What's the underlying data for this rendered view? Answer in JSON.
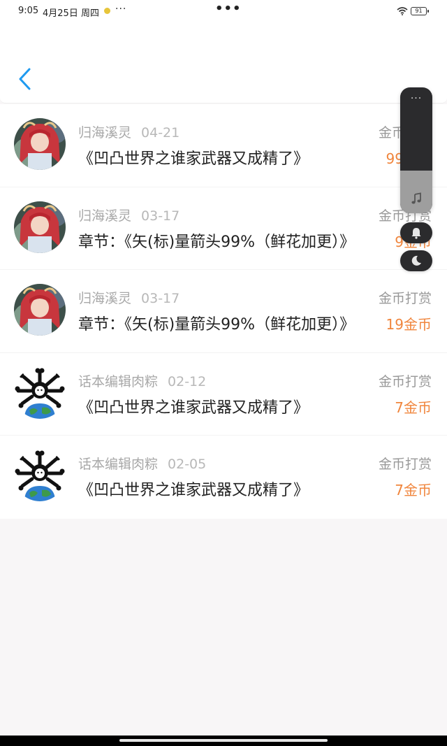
{
  "status_bar": {
    "time": "9:05",
    "date": "4月25日 周四",
    "more": "···",
    "center_dots": "•••",
    "battery": "91"
  },
  "header": {
    "back_icon": "chevron-left-icon",
    "accent": "#1e9af0"
  },
  "records": [
    {
      "user": "归海溪灵",
      "date": "04-21",
      "title": "《凹凸世界之谁家武器又成精了》",
      "type": "金币打赏",
      "amount": "99金币",
      "avatar": "anime-girl-avatar"
    },
    {
      "user": "归海溪灵",
      "date": "03-17",
      "title": "章节：《矢(标)量箭头99%（鲜花加更）》",
      "type": "金币打赏",
      "amount": "9金币",
      "avatar": "anime-girl-avatar"
    },
    {
      "user": "归海溪灵",
      "date": "03-17",
      "title": "章节：《矢(标)量箭头99%（鲜花加更）》",
      "type": "金币打赏",
      "amount": "19金币",
      "avatar": "anime-girl-avatar"
    },
    {
      "user": "话本编辑肉粽",
      "date": "02-12",
      "title": "《凹凸世界之谁家武器又成精了》",
      "type": "金币打赏",
      "amount": "7金币",
      "avatar": "bones-globe-avatar"
    },
    {
      "user": "话本编辑肉粽",
      "date": "02-05",
      "title": "《凹凸世界之谁家武器又成精了》",
      "type": "金币打赏",
      "amount": "7金币",
      "avatar": "bones-globe-avatar"
    }
  ],
  "float_panel": {
    "menu_dots": "···",
    "volume_level": 0.34,
    "icons": [
      "music-note-icon",
      "bell-icon",
      "moon-icon"
    ]
  },
  "colors": {
    "amount": "#f0853c",
    "panel": "#2b2b2d"
  }
}
